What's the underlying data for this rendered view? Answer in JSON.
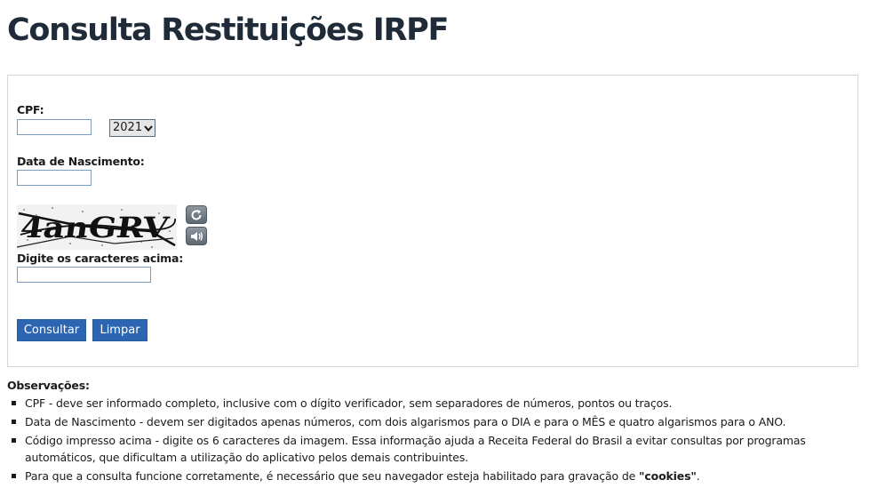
{
  "page": {
    "title": "Consulta Restituições IRPF"
  },
  "form": {
    "cpf_label": "CPF:",
    "cpf_value": "",
    "year_selected": "2021",
    "birth_label": "Data de Nascimento:",
    "birth_value": "",
    "captcha_text": "4anGRV",
    "captcha_label": "Digite os caracteres acima:",
    "captcha_value": "",
    "refresh_icon": "refresh-icon",
    "audio_icon": "audio-icon",
    "submit_label": "Consultar",
    "clear_label": "Limpar",
    "accent_color": "#2c66b3"
  },
  "observations": {
    "title": "Observações:",
    "items": [
      "CPF - deve ser informado completo, inclusive com o dígito verificador, sem separadores de números, pontos ou traços.",
      "Data de Nascimento - devem ser digitados apenas números, com dois algarismos para o DIA e para o MÊS e quatro algarismos para o ANO.",
      "Código impresso acima - digite os 6 caracteres da imagem. Essa informação ajuda a Receita Federal do Brasil a evitar consultas por programas automáticos, que dificultam a utilização do aplicativo pelos demais contribuintes."
    ],
    "cookie_prefix": "Para que a consulta funcione corretamente, é necessário que seu navegador esteja habilitado para gravação de ",
    "cookie_bold": "\"cookies\"",
    "cookie_suffix": "."
  }
}
